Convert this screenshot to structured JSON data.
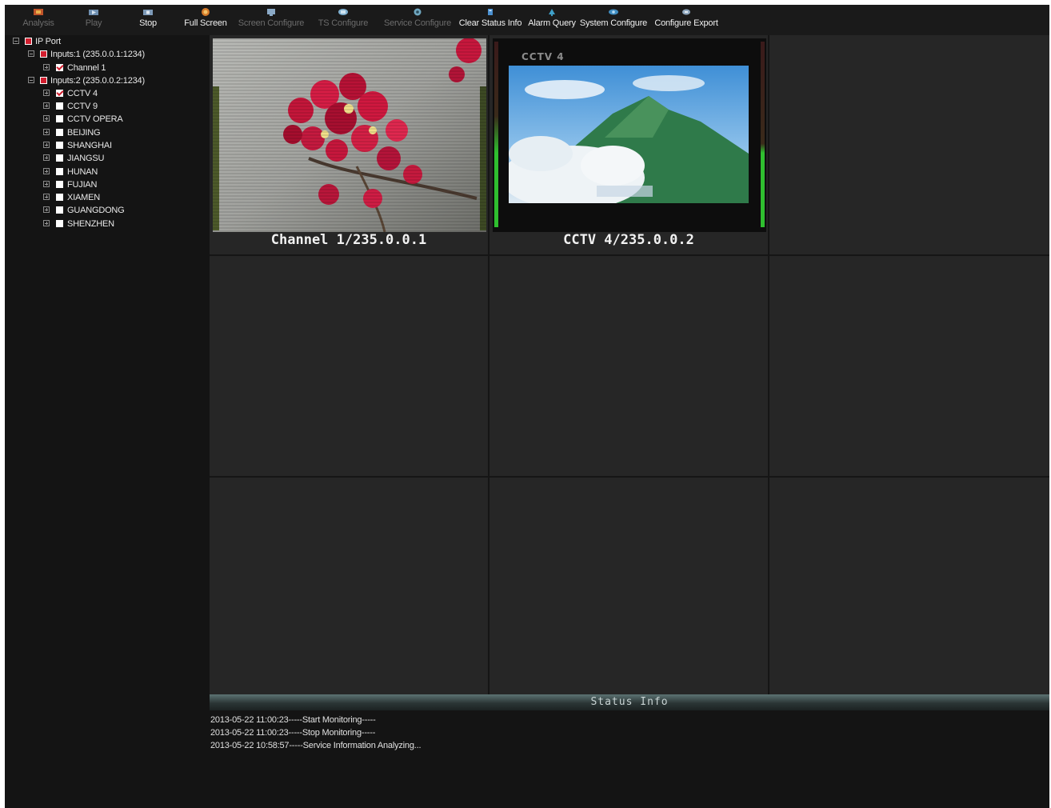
{
  "toolbar": {
    "items": [
      {
        "label": "Analysis",
        "icon": "analysis-icon",
        "enabled": false
      },
      {
        "label": "Play",
        "icon": "play-icon",
        "enabled": false
      },
      {
        "label": "Stop",
        "icon": "stop-icon",
        "enabled": true
      },
      {
        "label": "Full Screen",
        "icon": "full-screen-icon",
        "enabled": true
      },
      {
        "label": "Screen Configure",
        "icon": "screen-configure-icon",
        "enabled": false
      },
      {
        "label": "TS Configure",
        "icon": "ts-configure-icon",
        "enabled": false
      },
      {
        "label": "Service Configure",
        "icon": "service-configure-icon",
        "enabled": false
      },
      {
        "label": "Clear Status Info",
        "icon": "clear-status-icon",
        "enabled": true
      },
      {
        "label": "Alarm Query",
        "icon": "alarm-query-icon",
        "enabled": true
      },
      {
        "label": "System Configure",
        "icon": "system-configure-icon",
        "enabled": true
      },
      {
        "label": "Configure Export",
        "icon": "configure-export-icon",
        "enabled": true
      }
    ]
  },
  "tree": {
    "root": "IP Port",
    "input1": "Inputs:1 (235.0.0.1:1234)",
    "channel1": "Channel 1",
    "input2": "Inputs:2 (235.0.0.2:1234)",
    "services": [
      "CCTV 4",
      "CCTV 9",
      "CCTV OPERA",
      "BEIJING",
      "SHANGHAI",
      "JIANGSU",
      "HUNAN",
      "FUJIAN",
      "XIAMEN",
      "GUANGDONG",
      "SHENZHEN"
    ]
  },
  "video": {
    "cell1_caption": "Channel 1/235.0.0.1",
    "cell2_caption": "CCTV 4/235.0.0.2",
    "cell2_logo": "CCTV 4"
  },
  "status": {
    "title": "Status Info",
    "lines": [
      "2013-05-22 11:00:23-----Start Monitoring-----",
      "2013-05-22 11:00:23-----Stop Monitoring-----",
      "2013-05-22 10:58:57-----Service Information Analyzing..."
    ]
  },
  "colors": {
    "background": "#1b1b1b",
    "check_red": "#d21f2f",
    "audio_green": "#2fbf2f"
  }
}
